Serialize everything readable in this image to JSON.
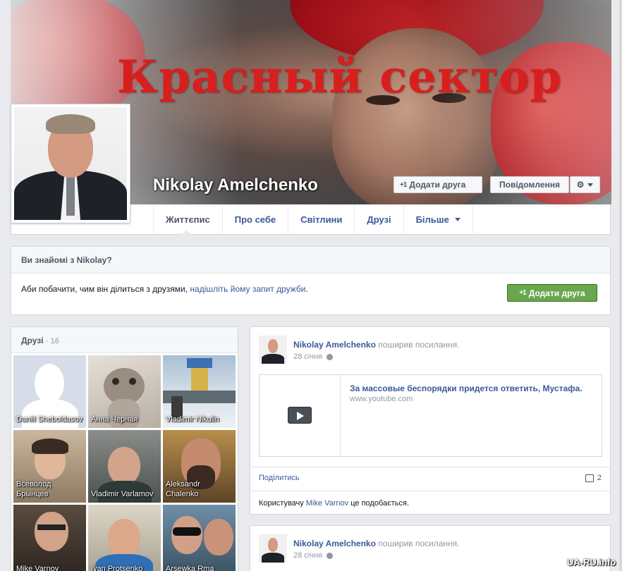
{
  "cover": {
    "title": "Красный сектор"
  },
  "profile": {
    "name": "Nikolay Amelchenko",
    "add_friend_label": "Додати друга",
    "message_label": "Повідомлення",
    "plus_glyph": "+1"
  },
  "tabs": [
    {
      "label": "Життєпис",
      "active": true
    },
    {
      "label": "Про себе"
    },
    {
      "label": "Світлини"
    },
    {
      "label": "Друзі"
    },
    {
      "label": "Більше"
    }
  ],
  "know_box": {
    "heading": "Ви знайомі з Nikolay?",
    "text_prefix": "Аби побачити, чим він ділиться з друзями, ",
    "link_text": "надішліть йому запит дружби",
    "text_suffix": ".",
    "button_label": "Додати друга"
  },
  "friends": {
    "heading": "Друзі",
    "count": "· 16",
    "items": [
      {
        "name": "Daniil Sheboldasov"
      },
      {
        "name": "Анна Черная"
      },
      {
        "name": "Vladimir Nikulin"
      },
      {
        "name": "Всеволод Брынцев"
      },
      {
        "name": "Vladimir Varlamov"
      },
      {
        "name": "Aleksandr Chalenko"
      },
      {
        "name": "Mike Varnov"
      },
      {
        "name": "Ivan Protsenko"
      },
      {
        "name": "Arsewka Rma"
      }
    ]
  },
  "posts": [
    {
      "author": "Nikolay Amelchenko",
      "action": "поширив посилання.",
      "date": "28 січня",
      "link_title": "За массовые беспорядки придется ответить, Мустафа.",
      "link_url": "www.youtube.com",
      "share_label": "Поділитись",
      "comment_count": "2",
      "likes_prefix": "Користувачу ",
      "likes_user": "Mike Varnov",
      "likes_suffix": " це подобається."
    },
    {
      "author": "Nikolay Amelchenko",
      "action": "поширив посилання.",
      "date": "28 січня"
    }
  ],
  "watermark": "UA-RU.info",
  "colors": {
    "link": "#3b5998",
    "green_button": "#69a74e",
    "cover_title": "#d91e1e"
  }
}
